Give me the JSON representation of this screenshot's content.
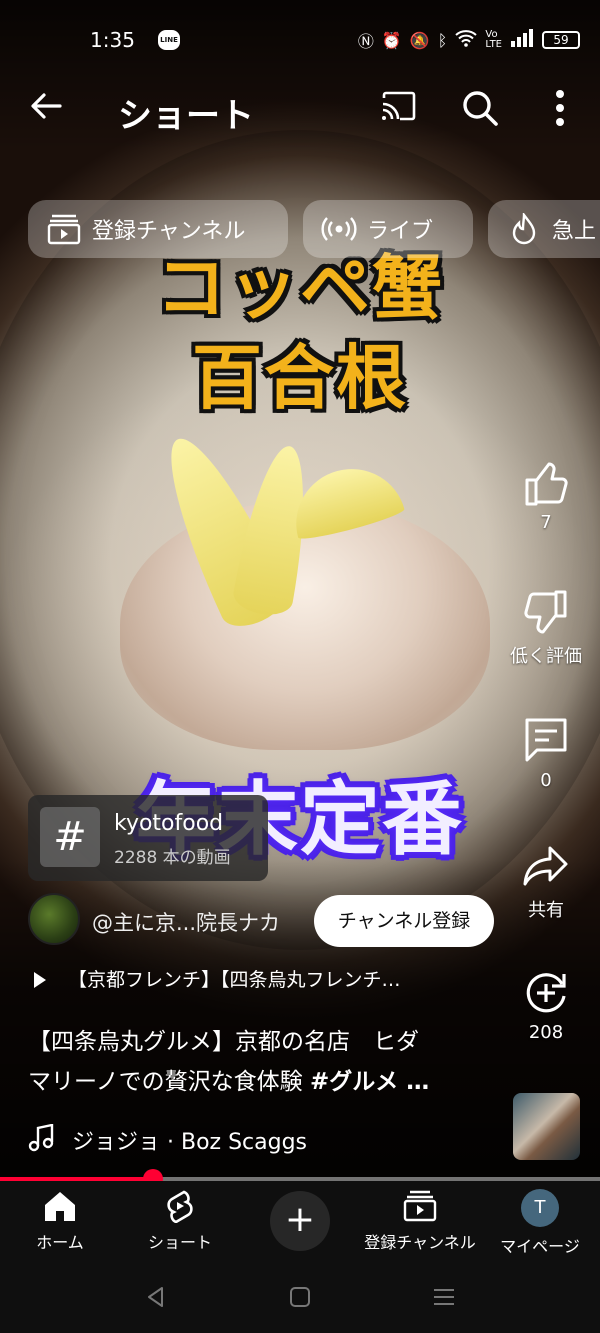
{
  "status_bar": {
    "time": "1:35",
    "line_badge": "LINE",
    "battery": "59",
    "icons": [
      "nfc-icon",
      "alarm-icon",
      "mute-icon",
      "bluetooth-icon",
      "wifi-icon",
      "volte-icon",
      "signal-icon",
      "battery-icon"
    ]
  },
  "top_bar": {
    "title": "ショート",
    "icons": [
      "back-arrow-icon",
      "cast-icon",
      "search-icon",
      "more-vert-icon"
    ]
  },
  "chips": [
    {
      "label": "登録チャンネル",
      "icon": "subscriptions-icon"
    },
    {
      "label": "ライブ",
      "icon": "live-icon"
    },
    {
      "label": "急上",
      "icon": "trending-icon"
    }
  ],
  "video_overlay": {
    "line1": "コッペ蟹",
    "line2": "百合根",
    "line3": "年末定番"
  },
  "actions": {
    "like_count": "7",
    "dislike_label": "低く評価",
    "comment_count": "0",
    "share_label": "共有",
    "remix_count": "208"
  },
  "hashtag": {
    "symbol": "#",
    "name": "kyotofood",
    "count": "2288 本の動画"
  },
  "channel": {
    "name": "@主に京...院長ナカ",
    "subscribe_label": "チャンネル登録"
  },
  "playlist": {
    "text": "【京都フレンチ】【四条烏丸フレンチ…"
  },
  "description": {
    "line1": "【四条烏丸グルメ】京都の名店　ヒダ",
    "line2_plain": "マリーノでの贅沢な食体験 ",
    "line2_tag": "#グルメ …"
  },
  "music": {
    "text": "ジョジョ · Boz Scaggs"
  },
  "progress": {
    "fraction": 0.255
  },
  "bottom_nav": {
    "home": "ホーム",
    "shorts": "ショート",
    "create": "+",
    "subscriptions": "登録チャンネル",
    "mypage": "マイページ",
    "avatar_letter": "T"
  },
  "colors": {
    "accent_red": "#ff0033",
    "overlay_yellow": "#f3b21b",
    "overlay_purple": "#4a23e6"
  }
}
